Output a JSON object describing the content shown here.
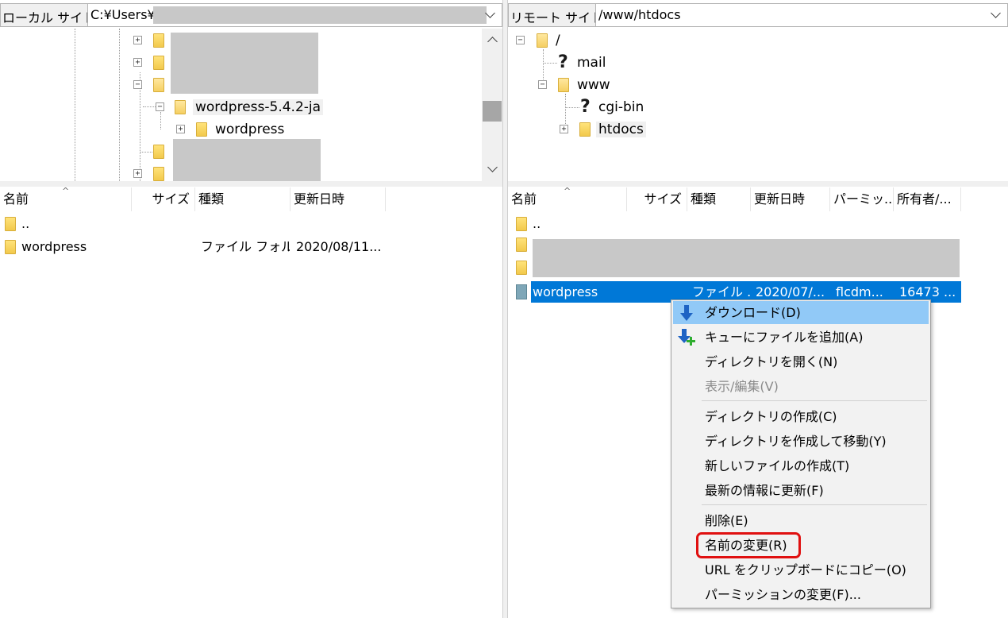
{
  "local": {
    "site_label": "ローカル サイト:",
    "site_path": "C:¥Users¥",
    "tree": [
      {
        "label": "wordpress-5.4.2-ja"
      },
      {
        "label": "wordpress"
      }
    ],
    "columns": [
      "名前",
      "サイズ",
      "種類",
      "更新日時"
    ],
    "files": [
      {
        "name": "..",
        "size": "",
        "type": "",
        "modified": ""
      },
      {
        "name": "wordpress",
        "size": "",
        "type": "ファイル フォル...",
        "modified": "2020/08/11..."
      }
    ]
  },
  "remote": {
    "site_label": "リモート サイト:",
    "site_path": "/www/htdocs",
    "tree": [
      {
        "label": "/"
      },
      {
        "label": "mail"
      },
      {
        "label": "www"
      },
      {
        "label": "cgi-bin"
      },
      {
        "label": "htdocs"
      }
    ],
    "columns": [
      "名前",
      "サイズ",
      "種類",
      "更新日時",
      "パーミッ...",
      "所有者/..."
    ],
    "files": [
      {
        "name": "..",
        "size": "",
        "type": "",
        "modified": "",
        "perms": "",
        "owner": ""
      },
      {
        "name": "wordpress",
        "size": "",
        "type": "ファイル ...",
        "modified": "2020/07/...",
        "perms": "flcdm...",
        "owner": "16473 ..."
      }
    ]
  },
  "context_menu": {
    "items": [
      {
        "label": "ダウンロード(D)",
        "icon": "download-arrow-icon",
        "state": "highlighted"
      },
      {
        "label": "キューにファイルを追加(A)",
        "icon": "add-to-queue-icon",
        "state": "normal"
      },
      {
        "label": "ディレクトリを開く(N)",
        "state": "normal"
      },
      {
        "label": "表示/編集(V)",
        "state": "disabled"
      },
      {
        "label": "ディレクトリの作成(C)",
        "state": "normal"
      },
      {
        "label": "ディレクトリを作成して移動(Y)",
        "state": "normal"
      },
      {
        "label": "新しいファイルの作成(T)",
        "state": "normal"
      },
      {
        "label": "最新の情報に更新(F)",
        "state": "normal"
      },
      {
        "label": "削除(E)",
        "state": "normal"
      },
      {
        "label": "名前の変更(R)",
        "state": "circled"
      },
      {
        "label": "URL をクリップボードにコピー(O)",
        "state": "normal"
      },
      {
        "label": "パーミッションの変更(F)...",
        "state": "normal"
      }
    ]
  },
  "colors": {
    "selection": "#0078d7",
    "menu_highlight": "#91c9f7",
    "annotation_ring": "#e01010",
    "redaction": "#c8c8c8"
  }
}
